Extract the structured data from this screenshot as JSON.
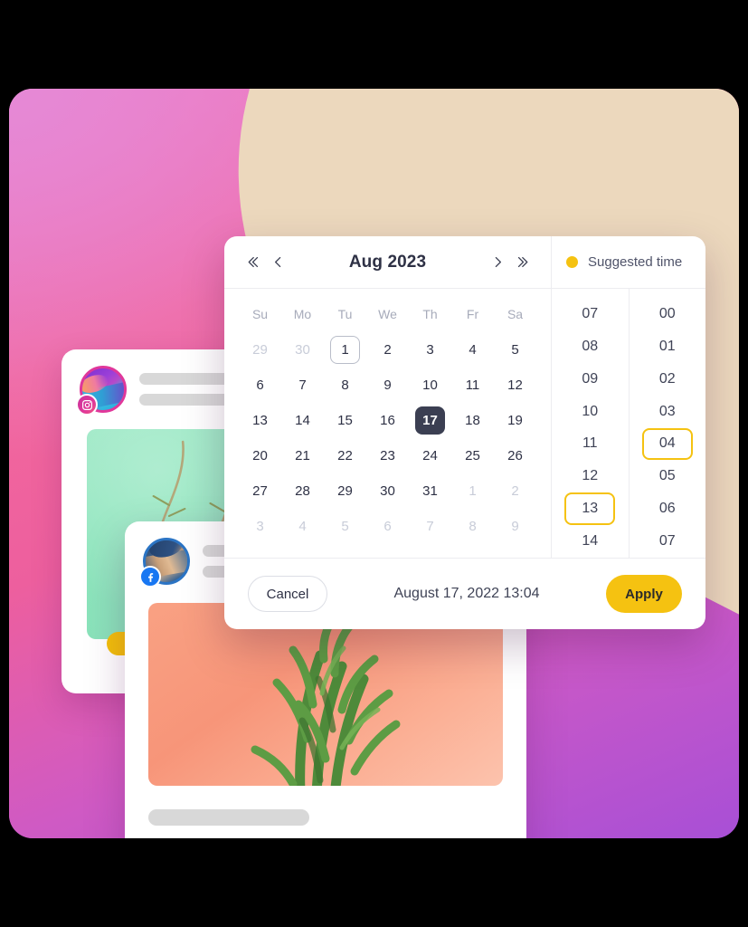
{
  "popup": {
    "calendar": {
      "title": "Aug 2023",
      "nav": {
        "prev_year_icon": "double-chevron-left-icon",
        "prev_month_icon": "chevron-left-icon",
        "next_month_icon": "chevron-right-icon",
        "next_year_icon": "double-chevron-right-icon"
      },
      "weekdays": [
        "Su",
        "Mo",
        "Tu",
        "We",
        "Th",
        "Fr",
        "Sa"
      ],
      "weeks": [
        [
          {
            "d": "29",
            "state": "muted"
          },
          {
            "d": "30",
            "state": "muted"
          },
          {
            "d": "1",
            "state": "today"
          },
          {
            "d": "2",
            "state": "normal"
          },
          {
            "d": "3",
            "state": "normal"
          },
          {
            "d": "4",
            "state": "normal"
          },
          {
            "d": "5",
            "state": "normal"
          }
        ],
        [
          {
            "d": "6",
            "state": "normal"
          },
          {
            "d": "7",
            "state": "normal"
          },
          {
            "d": "8",
            "state": "normal"
          },
          {
            "d": "9",
            "state": "normal"
          },
          {
            "d": "10",
            "state": "normal"
          },
          {
            "d": "11",
            "state": "normal"
          },
          {
            "d": "12",
            "state": "normal"
          }
        ],
        [
          {
            "d": "13",
            "state": "normal"
          },
          {
            "d": "14",
            "state": "normal"
          },
          {
            "d": "15",
            "state": "normal"
          },
          {
            "d": "16",
            "state": "normal"
          },
          {
            "d": "17",
            "state": "selected"
          },
          {
            "d": "18",
            "state": "normal"
          },
          {
            "d": "19",
            "state": "normal"
          }
        ],
        [
          {
            "d": "20",
            "state": "normal"
          },
          {
            "d": "21",
            "state": "normal"
          },
          {
            "d": "22",
            "state": "normal"
          },
          {
            "d": "23",
            "state": "normal"
          },
          {
            "d": "24",
            "state": "normal"
          },
          {
            "d": "25",
            "state": "normal"
          },
          {
            "d": "26",
            "state": "normal"
          }
        ],
        [
          {
            "d": "27",
            "state": "normal"
          },
          {
            "d": "28",
            "state": "normal"
          },
          {
            "d": "29",
            "state": "normal"
          },
          {
            "d": "30",
            "state": "normal"
          },
          {
            "d": "31",
            "state": "normal"
          },
          {
            "d": "1",
            "state": "muted"
          },
          {
            "d": "2",
            "state": "muted"
          }
        ],
        [
          {
            "d": "3",
            "state": "muted"
          },
          {
            "d": "4",
            "state": "muted"
          },
          {
            "d": "5",
            "state": "muted"
          },
          {
            "d": "6",
            "state": "muted"
          },
          {
            "d": "7",
            "state": "muted"
          },
          {
            "d": "8",
            "state": "muted"
          },
          {
            "d": "9",
            "state": "muted"
          }
        ]
      ]
    },
    "suggested": {
      "label": "Suggested time",
      "dot_color": "#f5c211",
      "dot_icon": "yellow-dot-icon"
    },
    "time": {
      "hours": [
        "07",
        "08",
        "09",
        "10",
        "11",
        "12",
        "13",
        "14"
      ],
      "hours_selected": "13",
      "minutes": [
        "00",
        "01",
        "02",
        "03",
        "04",
        "05",
        "06",
        "07"
      ],
      "minutes_selected": "04"
    },
    "footer": {
      "cancel_label": "Cancel",
      "selected_datetime": "August 17, 2022 13:04",
      "apply_label": "Apply"
    }
  },
  "cards": {
    "back": {
      "network": "instagram",
      "badge_icon": "instagram-icon",
      "avatar_icon": "avatar",
      "photo_alt": "mint-green-plant-photo",
      "action_pill": "yellow-action-pill"
    },
    "front": {
      "network": "facebook",
      "badge_icon": "facebook-icon",
      "avatar_icon": "avatar",
      "photo_alt": "coral-cactus-photo"
    }
  },
  "theme": {
    "accent_yellow": "#f5c211",
    "selected_dark": "#3b3f52",
    "bg_pink": "#ef6ea4",
    "bg_purple": "#a84fd6",
    "bg_beige": "#ecd8bd"
  }
}
